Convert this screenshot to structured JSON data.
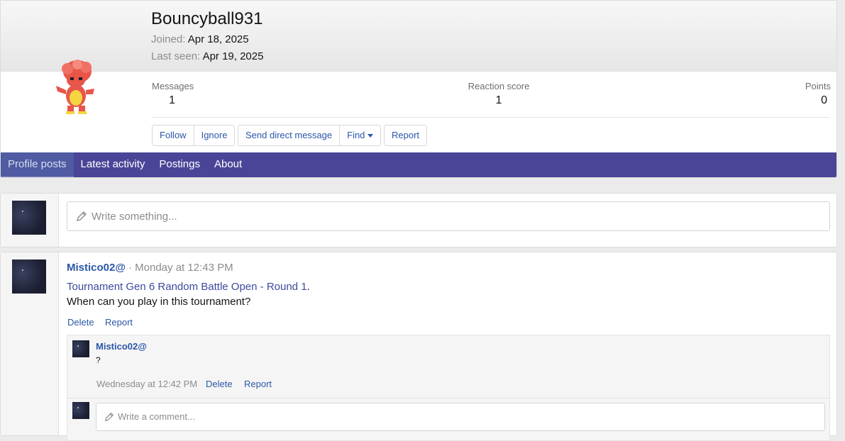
{
  "profile": {
    "username": "Bouncyball931",
    "joined_label": "Joined:",
    "joined_value": "Apr 18, 2025",
    "last_seen_label": "Last seen:",
    "last_seen_value": "Apr 19, 2025",
    "avatar_icon": "pokemon-sprite-icon",
    "stats": [
      {
        "label": "Messages",
        "value": "1"
      },
      {
        "label": "Reaction score",
        "value": "1"
      },
      {
        "label": "Points",
        "value": "0"
      }
    ],
    "buttons": {
      "follow": "Follow",
      "ignore": "Ignore",
      "send_dm": "Send direct message",
      "find": "Find",
      "report": "Report"
    }
  },
  "tabs": [
    {
      "label": "Profile posts",
      "active": true
    },
    {
      "label": "Latest activity",
      "active": false
    },
    {
      "label": "Postings",
      "active": false
    },
    {
      "label": "About",
      "active": false
    }
  ],
  "composer": {
    "placeholder": "Write something..."
  },
  "post": {
    "author": "Mistico02@",
    "time": "· Monday at 12:43 PM",
    "link_text": "Tournament Gen 6 Random Battle Open - Round 1",
    "link_suffix": ".",
    "body": "When can you play in this tournament?",
    "actions": {
      "delete": "Delete",
      "report": "Report"
    },
    "comment": {
      "author": "Mistico02@",
      "body": "?",
      "time": "Wednesday at 12:42 PM",
      "delete": "Delete",
      "report": "Report"
    },
    "comment_placeholder": "Write a comment..."
  },
  "colors": {
    "accent": "#4a4597",
    "link": "#2b57a8",
    "tab_active_bg": "#4f5ba2"
  }
}
